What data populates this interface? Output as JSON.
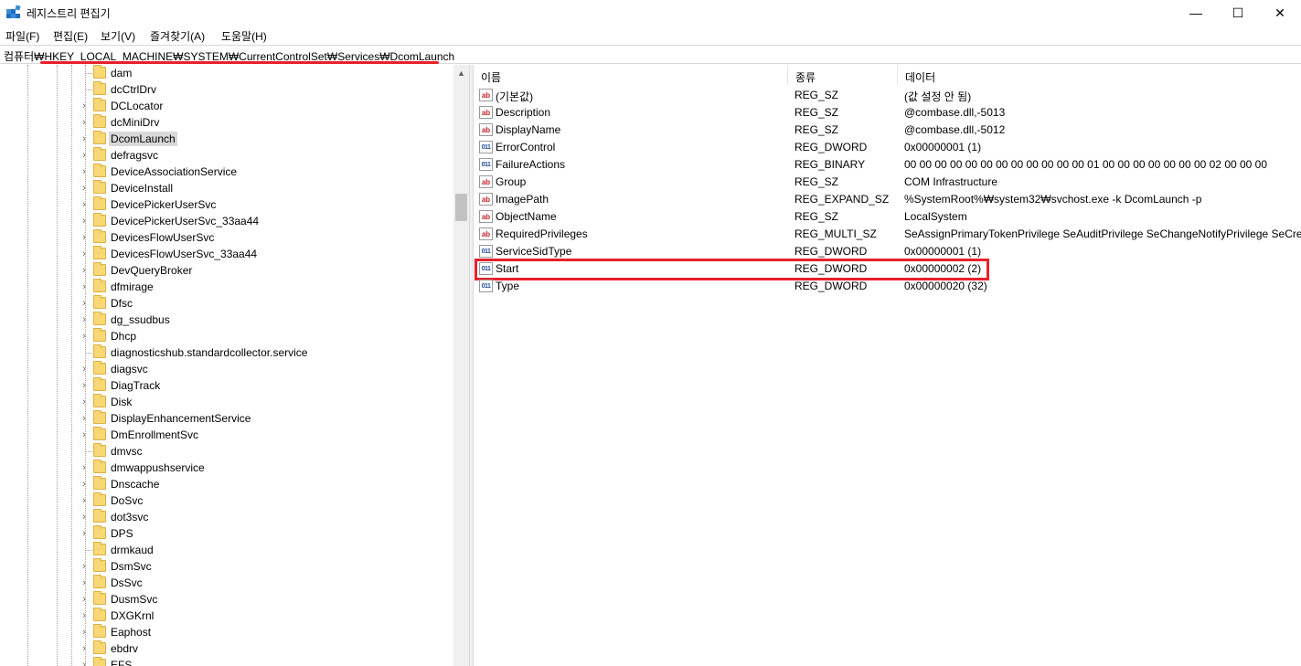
{
  "window": {
    "title": "레지스트리 편집기",
    "icon": "registry-editor-icon",
    "controls": {
      "minimize": "—",
      "maximize": "☐",
      "close": "✕"
    }
  },
  "menu": [
    "파일(F)",
    "편집(E)",
    "보기(V)",
    "즐겨찾기(A)",
    "도움말(H)"
  ],
  "address": "컴퓨터₩HKEY_LOCAL_MACHINE₩SYSTEM₩CurrentControlSet₩Services₩DcomLaunch",
  "tree": {
    "items": [
      {
        "label": "dam",
        "expandable": false
      },
      {
        "label": "dcCtrlDrv",
        "expandable": false
      },
      {
        "label": "DCLocator",
        "expandable": true
      },
      {
        "label": "dcMiniDrv",
        "expandable": true
      },
      {
        "label": "DcomLaunch",
        "expandable": true,
        "selected": true
      },
      {
        "label": "defragsvc",
        "expandable": true
      },
      {
        "label": "DeviceAssociationService",
        "expandable": true
      },
      {
        "label": "DeviceInstall",
        "expandable": true
      },
      {
        "label": "DevicePickerUserSvc",
        "expandable": true
      },
      {
        "label": "DevicePickerUserSvc_33aa44",
        "expandable": true
      },
      {
        "label": "DevicesFlowUserSvc",
        "expandable": true
      },
      {
        "label": "DevicesFlowUserSvc_33aa44",
        "expandable": true
      },
      {
        "label": "DevQueryBroker",
        "expandable": true
      },
      {
        "label": "dfmirage",
        "expandable": true
      },
      {
        "label": "Dfsc",
        "expandable": true
      },
      {
        "label": "dg_ssudbus",
        "expandable": true
      },
      {
        "label": "Dhcp",
        "expandable": true
      },
      {
        "label": "diagnosticshub.standardcollector.service",
        "expandable": false
      },
      {
        "label": "diagsvc",
        "expandable": true
      },
      {
        "label": "DiagTrack",
        "expandable": true
      },
      {
        "label": "Disk",
        "expandable": true
      },
      {
        "label": "DisplayEnhancementService",
        "expandable": true
      },
      {
        "label": "DmEnrollmentSvc",
        "expandable": true
      },
      {
        "label": "dmvsc",
        "expandable": false
      },
      {
        "label": "dmwappushservice",
        "expandable": true
      },
      {
        "label": "Dnscache",
        "expandable": true
      },
      {
        "label": "DoSvc",
        "expandable": true
      },
      {
        "label": "dot3svc",
        "expandable": true
      },
      {
        "label": "DPS",
        "expandable": true
      },
      {
        "label": "drmkaud",
        "expandable": false
      },
      {
        "label": "DsmSvc",
        "expandable": true
      },
      {
        "label": "DsSvc",
        "expandable": true
      },
      {
        "label": "DusmSvc",
        "expandable": true
      },
      {
        "label": "DXGKrnl",
        "expandable": true
      },
      {
        "label": "Eaphost",
        "expandable": true
      },
      {
        "label": "ebdrv",
        "expandable": true
      },
      {
        "label": "EFS",
        "expandable": true
      }
    ],
    "expander_glyph": "›"
  },
  "columns": {
    "name": "이름",
    "type": "종류",
    "data": "데이터"
  },
  "values": [
    {
      "name": "(기본값)",
      "type": "REG_SZ",
      "data": "(값 설정 안 됨)",
      "kind": "sz"
    },
    {
      "name": "Description",
      "type": "REG_SZ",
      "data": "@combase.dll,-5013",
      "kind": "sz"
    },
    {
      "name": "DisplayName",
      "type": "REG_SZ",
      "data": "@combase.dll,-5012",
      "kind": "sz"
    },
    {
      "name": "ErrorControl",
      "type": "REG_DWORD",
      "data": "0x00000001 (1)",
      "kind": "bin"
    },
    {
      "name": "FailureActions",
      "type": "REG_BINARY",
      "data": "00 00 00 00 00 00 00 00 00 00 00 00 01 00 00 00 00 00 00 00 02 00 00 00",
      "kind": "bin"
    },
    {
      "name": "Group",
      "type": "REG_SZ",
      "data": "COM Infrastructure",
      "kind": "sz"
    },
    {
      "name": "ImagePath",
      "type": "REG_EXPAND_SZ",
      "data": "%SystemRoot%₩system32₩svchost.exe -k DcomLaunch -p",
      "kind": "sz"
    },
    {
      "name": "ObjectName",
      "type": "REG_SZ",
      "data": "LocalSystem",
      "kind": "sz"
    },
    {
      "name": "RequiredPrivileges",
      "type": "REG_MULTI_SZ",
      "data": "SeAssignPrimaryTokenPrivilege SeAuditPrivilege SeChangeNotifyPrivilege SeCrea",
      "kind": "sz"
    },
    {
      "name": "ServiceSidType",
      "type": "REG_DWORD",
      "data": "0x00000001 (1)",
      "kind": "bin"
    },
    {
      "name": "Start",
      "type": "REG_DWORD",
      "data": "0x00000002 (2)",
      "kind": "bin",
      "highlighted": true
    },
    {
      "name": "Type",
      "type": "REG_DWORD",
      "data": "0x00000020 (32)",
      "kind": "bin"
    }
  ],
  "icon_text": {
    "sz": "ab",
    "bin": "011"
  },
  "colors": {
    "highlight": "#e8202a",
    "folder": "#f8d775",
    "selection": "#d9d9d9"
  }
}
